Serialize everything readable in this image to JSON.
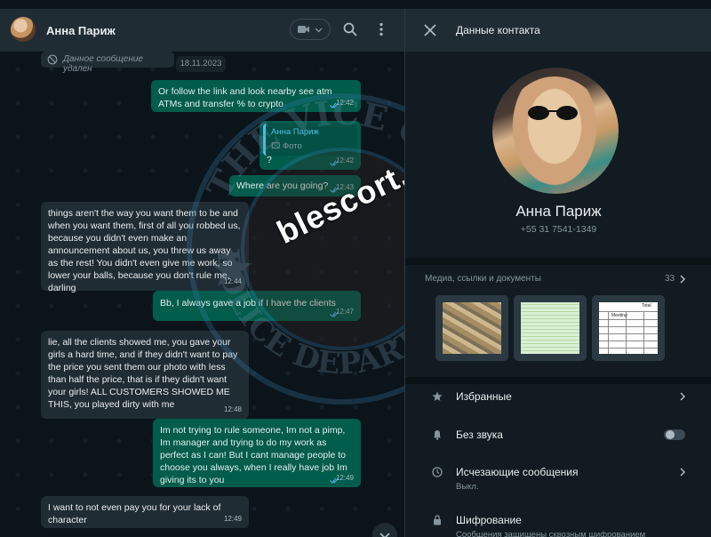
{
  "chat": {
    "contact_name": "Анна Париж",
    "deleted_text": "Данное сообщение удален",
    "date_pill": "18.11.2023",
    "quote_author": "Анна Париж",
    "quote_photo": "🖾 Фото",
    "messages": [
      {
        "dir": "out",
        "text": "Or follow the link and look nearby see atm ATMs and transfer % to crypto",
        "time": "12:42",
        "read": true
      },
      {
        "dir": "out",
        "text": "?",
        "time": "12:42",
        "read": true,
        "has_quote": true
      },
      {
        "dir": "out",
        "text": "Where are you going?",
        "time": "12:43",
        "read": true
      },
      {
        "dir": "in",
        "text": "things aren't the way you want them to be and when you want them, first of all you robbed us, because you didn't even make an announcement about us, you threw us away as the rest! You didn't even give me work, so lower your balls, because you don't rule me, darling",
        "time": "12:44"
      },
      {
        "dir": "out",
        "text": "Bb, I always gave a job if I have the clients",
        "time": "12:47",
        "read": true
      },
      {
        "dir": "in",
        "text": "lie, all the clients showed me, you gave your girls a hard time, and if they didn't want to pay the price you sent them our photo with less than half the price, that is if they didn't want your girls! ALL CUSTOMERS SHOWED ME THIS, you played dirty with me",
        "time": "12:48"
      },
      {
        "dir": "out",
        "text": "Im not trying to rule someone, Im not a pimp, Im manager and trying to do my work as perfect as I can! But I cant manage people to choose you always, when I really have job Im giving its to you",
        "time": "12:49",
        "read": true
      },
      {
        "dir": "in",
        "text": "I want to not even pay you for your lack of character",
        "time": "12:49"
      }
    ]
  },
  "watermark": {
    "top_text": "THE VICE CITY",
    "bottom_text": "POLICE DEPARTMENT",
    "site": "blescort.cc"
  },
  "info": {
    "title": "Данные контакта",
    "name": "Анна Париж",
    "phone": "+55 31 7541-1349",
    "media_label": "Медиа, ссылки и документы",
    "media_count": "33",
    "thumb3_label": "Total",
    "thumb3_sub": "Meeting",
    "rows": [
      {
        "label": "Избранные",
        "sub": ""
      },
      {
        "label": "Без звука",
        "sub": ""
      },
      {
        "label": "Исчезающие сообщения",
        "sub": "Выкл."
      },
      {
        "label": "Шифрование",
        "sub": "Сообщения защищены сквозным шифрованием"
      }
    ]
  },
  "icons": {
    "search": "search-icon",
    "menu": "menu-dots-icon",
    "video": "video-call-icon",
    "close": "close-icon",
    "star": "star-icon",
    "bell": "bell-icon",
    "timer": "timer-icon",
    "lock": "lock-icon"
  },
  "colors": {
    "outgoing": "#005c4b",
    "incoming": "#202c33",
    "header": "#202c33",
    "background": "#111b21",
    "read_tick": "#53bdeb"
  }
}
